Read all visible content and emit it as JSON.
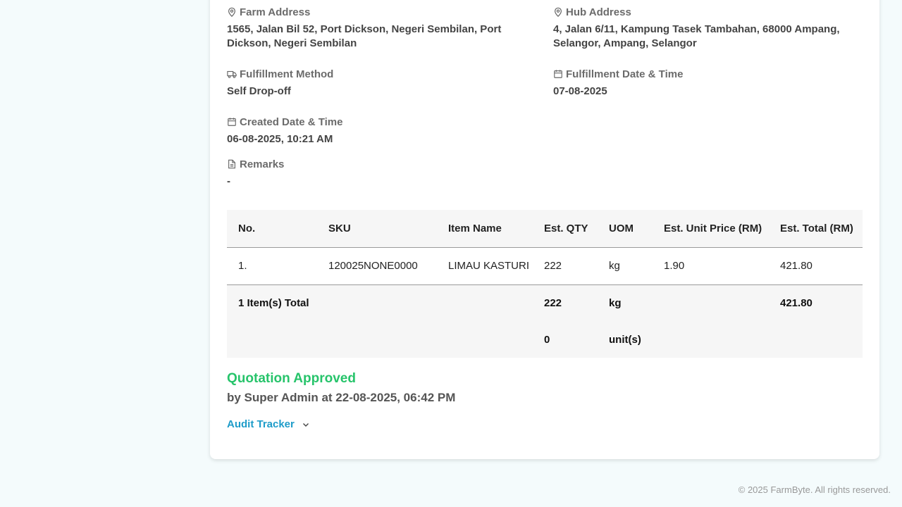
{
  "details": {
    "farm_address": {
      "label": "Farm Address",
      "value": "1565, Jalan Bil 52, Port Dickson, Negeri Sembilan, Port Dickson, Negeri Sembilan"
    },
    "hub_address": {
      "label": "Hub Address",
      "value": "4, Jalan 6/11, Kampung Tasek Tambahan, 68000 Ampang, Selangor, Ampang, Selangor"
    },
    "fulfillment_method": {
      "label": "Fulfillment Method",
      "value": "Self Drop-off"
    },
    "fulfillment_datetime": {
      "label": "Fulfillment Date & Time",
      "value": "07-08-2025"
    },
    "created_datetime": {
      "label": "Created Date & Time",
      "value": "06-08-2025, 10:21 AM"
    },
    "remarks": {
      "label": "Remarks",
      "value": "-"
    }
  },
  "table": {
    "headers": [
      "No.",
      "SKU",
      "Item Name",
      "Est. QTY",
      "UOM",
      "Est. Unit Price (RM)",
      "Est. Total (RM)"
    ],
    "rows": [
      [
        "1.",
        "120025NONE0000",
        "LIMAU KASTURI",
        "222",
        "kg",
        "1.90",
        "421.80"
      ]
    ],
    "total": {
      "label": "1 Item(s) Total",
      "qty_1": "222",
      "uom_1": "kg",
      "total": "421.80",
      "qty_2": "0",
      "uom_2": "unit(s)"
    }
  },
  "status": {
    "title": "Quotation Approved",
    "by": "by Super Admin at 22-08-2025, 06:42 PM"
  },
  "audit_tracker": {
    "label": "Audit Tracker"
  },
  "footer": {
    "text": "© 2025 FarmByte. All rights reserved."
  },
  "colors": {
    "approved": "#27c46b",
    "link": "#1e9cc9"
  }
}
